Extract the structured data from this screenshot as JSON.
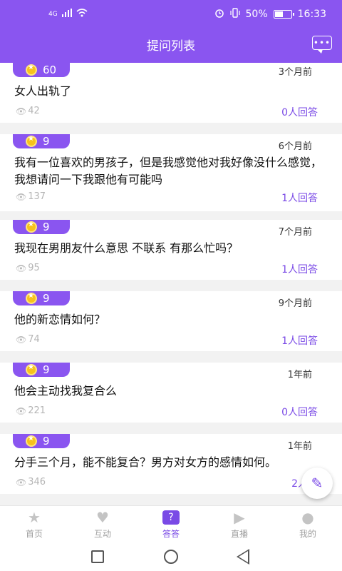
{
  "status_bar": {
    "signal_label": "4G",
    "battery": "50%",
    "time": "16:33"
  },
  "header": {
    "title": "提问列表",
    "message_icon": "chat-bubble-icon"
  },
  "questions": [
    {
      "coins": "60",
      "time": "3个月前",
      "text": "女人出轨了",
      "views": "42",
      "answers": "0人回答"
    },
    {
      "coins": "9",
      "time": "6个月前",
      "text": "我有一位喜欢的男孩子，但是我感觉他对我好像没什么感觉，我想请问一下我跟他有可能吗",
      "views": "137",
      "answers": "1人回答"
    },
    {
      "coins": "9",
      "time": "7个月前",
      "text": "我现在男朋友什么意思 不联系 有那么忙吗？",
      "views": "95",
      "answers": "1人回答"
    },
    {
      "coins": "9",
      "time": "9个月前",
      "text": "他的新恋情如何？",
      "views": "74",
      "answers": "1人回答"
    },
    {
      "coins": "9",
      "time": "1年前",
      "text": "他会主动找我复合么",
      "views": "221",
      "answers": "0人回答"
    },
    {
      "coins": "9",
      "time": "1年前",
      "text": "分手三个月，能不能复合？男方对女方的感情如何。",
      "views": "346",
      "answers": "2人回"
    }
  ],
  "tabs": [
    {
      "label": "首页",
      "icon": "star-home-icon"
    },
    {
      "label": "互动",
      "icon": "heart-box-icon"
    },
    {
      "label": "答答",
      "icon": "question-icon"
    },
    {
      "label": "直播",
      "icon": "camera-icon"
    },
    {
      "label": "我的",
      "icon": "person-icon"
    }
  ],
  "fab_icon": "pencil-icon",
  "colors": {
    "accent": "#8a55f0",
    "answer_text": "#7a4ae6"
  }
}
